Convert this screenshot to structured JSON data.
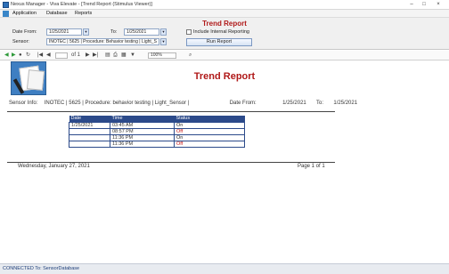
{
  "window": {
    "title": "Nexus Manager - Viva Elevate - [Trend Report (Stimulus Viewer)]",
    "minimize": "–",
    "maximize": "□",
    "close": "×"
  },
  "menu": {
    "items": [
      "Application",
      "Database",
      "Reports"
    ]
  },
  "form": {
    "title": "Trend Report",
    "date_from_label": "Date From:",
    "date_from_value": "1/25/2021",
    "to_label": "To:",
    "to_value": "1/25/2021",
    "checkbox_label": "Include Internal Reporting",
    "sensor_label": "Sensor:",
    "sensor_value": "INOTEC | 5625 | Procedure: Behavior testing | Light_S",
    "run_button": "Run Report"
  },
  "toolbar": {
    "page_of": "of 1",
    "zoom": "100%"
  },
  "report": {
    "title": "Trend Report",
    "sensor_info_label": "Sensor Info:",
    "sensor_info_value": "INOTEC | 5625 | Procedure: behavior testing | Light_Sensor |",
    "date_from_label": "Date From:",
    "date_from_value": "1/25/2021",
    "to_label": "To:",
    "to_value": "1/25/2021",
    "columns": [
      "Date",
      "Time",
      "Status"
    ],
    "rows": [
      {
        "date": "1/25/2021",
        "time": "03:45 AM",
        "status": "On",
        "color": "#222222"
      },
      {
        "date": "",
        "time": "08:57 PM",
        "status": "Off",
        "color": "#c41414"
      },
      {
        "date": "",
        "time": "11:36 PM",
        "status": "On",
        "color": "#222222"
      },
      {
        "date": "",
        "time": "11:36 PM",
        "status": "Off",
        "color": "#c41414"
      }
    ],
    "footer_date": "Wednesday, January 27, 2021",
    "footer_page": "Page 1 of 1"
  },
  "status_bar": {
    "text": "CONNECTED To: SensorDatabase"
  },
  "colors": {
    "accent_red": "#b01919",
    "header_blue": "#2c4a8a",
    "off_red": "#c41414"
  }
}
